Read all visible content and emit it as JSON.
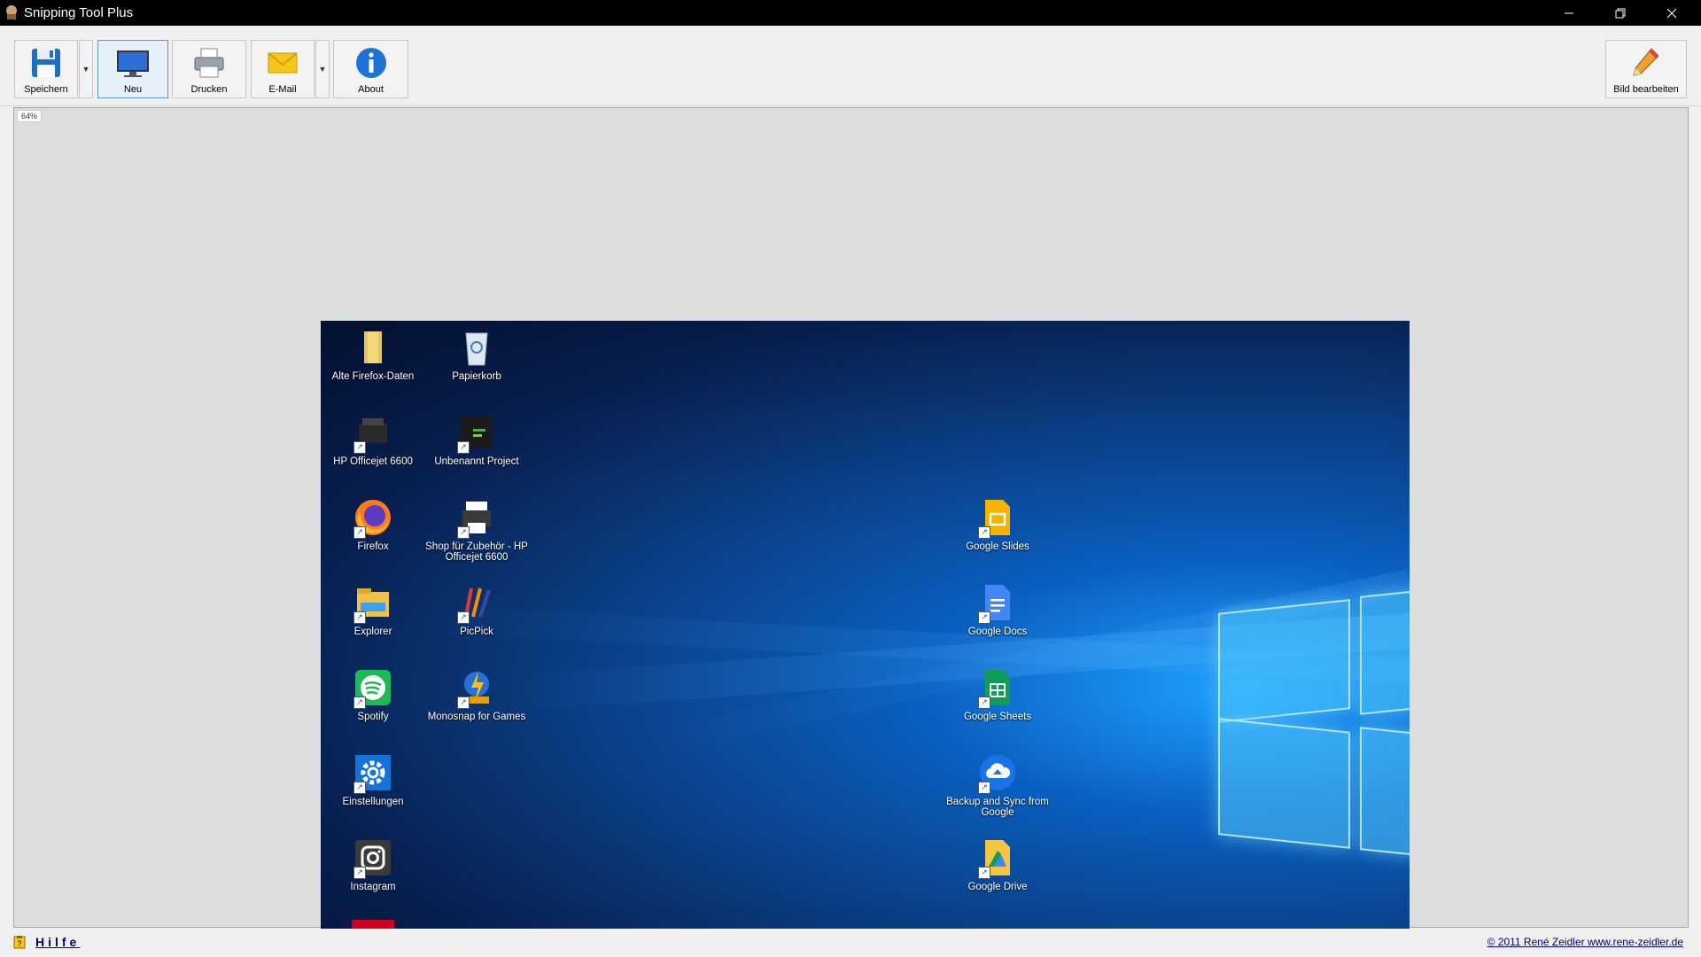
{
  "window": {
    "title": "Snipping Tool Plus"
  },
  "toolbar": {
    "save_label": "Speichern",
    "new_label": "Neu",
    "print_label": "Drucken",
    "email_label": "E-Mail",
    "about_label": "About",
    "edit_label": "Bild bearbeiten"
  },
  "canvas": {
    "zoom": "64%"
  },
  "desktop_icons": [
    {
      "label": "Alte Firefox-Daten",
      "icon": "folder-icon"
    },
    {
      "label": "Papierkorb",
      "icon": "recycle-bin-icon"
    },
    {
      "label": "HP Officejet 6600",
      "icon": "printer-icon"
    },
    {
      "label": "Unbenannt Project",
      "icon": "project-icon"
    },
    {
      "label": "Firefox",
      "icon": "firefox-icon"
    },
    {
      "label": "Shop für Zubehör - HP Officejet 6600",
      "icon": "printer-shop-icon"
    },
    {
      "label": "Explorer",
      "icon": "explorer-icon"
    },
    {
      "label": "PicPick",
      "icon": "picpick-icon"
    },
    {
      "label": "Spotify",
      "icon": "spotify-icon"
    },
    {
      "label": "Monosnap for Games",
      "icon": "monosnap-icon"
    },
    {
      "label": "Einstellungen",
      "icon": "settings-gear-icon"
    },
    {
      "label": "Instagram",
      "icon": "instagram-icon"
    },
    {
      "label": "Google Slides",
      "icon": "google-slides-icon"
    },
    {
      "label": "Google Docs",
      "icon": "google-docs-icon"
    },
    {
      "label": "Google Sheets",
      "icon": "google-sheets-icon"
    },
    {
      "label": "Backup and Sync from Google",
      "icon": "backup-sync-icon"
    },
    {
      "label": "Google Drive",
      "icon": "google-drive-icon"
    }
  ],
  "statusbar": {
    "help": "Hilfe",
    "copyright": "© 2011 René Zeidler www.rene-zeidler.de"
  },
  "colors": {
    "titlebar": "#000000",
    "accent": "#5b9bd5",
    "link": "#000080"
  }
}
